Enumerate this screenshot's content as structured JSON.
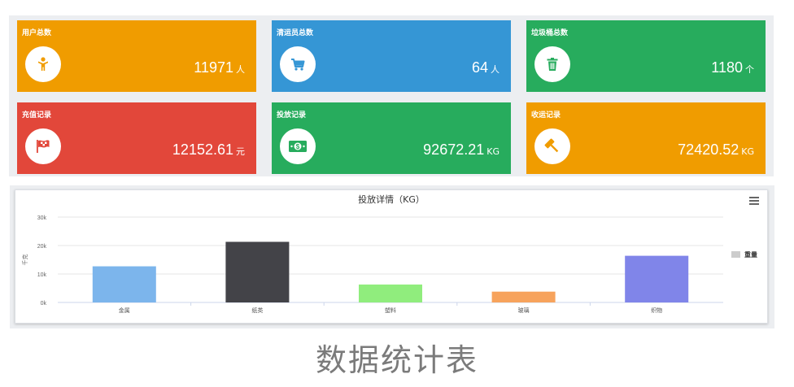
{
  "cards": [
    {
      "title": "用户总数",
      "value": "11971",
      "unit": "人",
      "icon": "person-icon",
      "color": "#f09c00"
    },
    {
      "title": "清运员总数",
      "value": "64",
      "unit": "人",
      "icon": "cart-icon",
      "color": "#3596d5"
    },
    {
      "title": "垃圾桶总数",
      "value": "1180",
      "unit": "个",
      "icon": "trash-icon",
      "color": "#27ac5d"
    },
    {
      "title": "充值记录",
      "value": "12152.61",
      "unit": "元",
      "icon": "flag-icon",
      "color": "#e2473a"
    },
    {
      "title": "投放记录",
      "value": "92672.21",
      "unit": "KG",
      "icon": "money-icon",
      "color": "#27ac5d"
    },
    {
      "title": "收运记录",
      "value": "72420.52",
      "unit": "KG",
      "icon": "gavel-icon",
      "color": "#f09c00"
    }
  ],
  "chart_data": {
    "type": "bar",
    "title": "投放详情（KG）",
    "ylabel": "千克",
    "categories": [
      "金属",
      "纸类",
      "塑料",
      "玻璃",
      "织物"
    ],
    "series": [
      {
        "name": "重量",
        "values": [
          12700,
          21300,
          6300,
          3800,
          16400
        ]
      }
    ],
    "colors": [
      "#7cb5ec",
      "#434348",
      "#90ed7d",
      "#f7a35c",
      "#8085e9"
    ],
    "legend_color": "#cccccc",
    "ylim": [
      0,
      30000
    ],
    "yticks": [
      "0k",
      "10k",
      "20k",
      "30k"
    ],
    "legend_position": "right",
    "grid": true
  },
  "caption": "数据统计表"
}
